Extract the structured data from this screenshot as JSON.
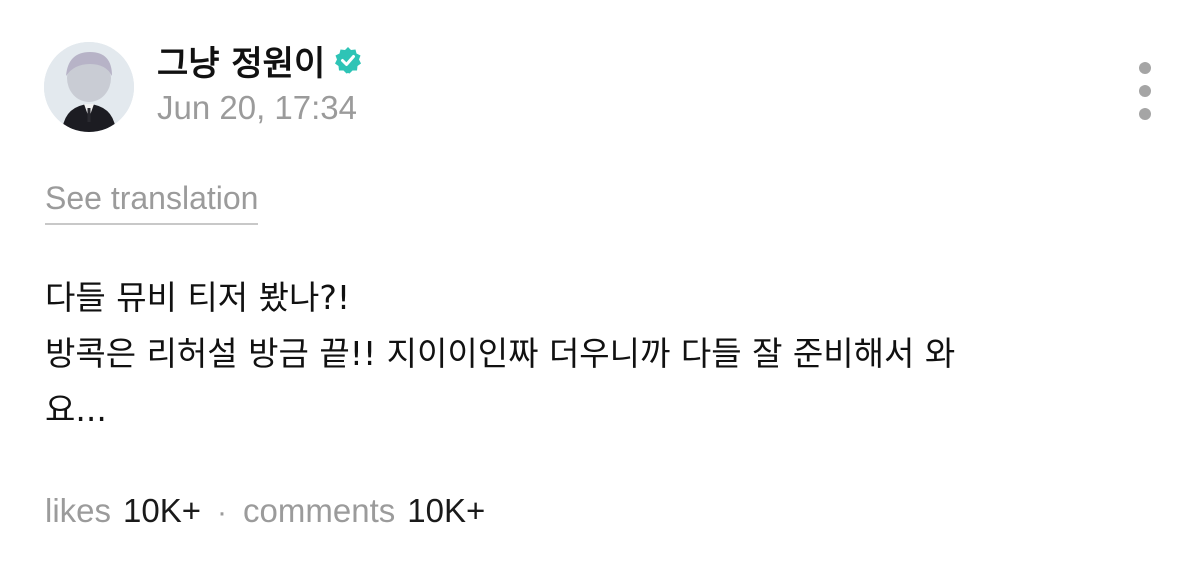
{
  "post": {
    "author": {
      "name": "그냥 정원이",
      "verified": true,
      "avatar_icon": "avatar-photo"
    },
    "timestamp": "Jun 20, 17:34",
    "see_translation": "See translation",
    "body_lines": [
      "다들 뮤비 티저 봤나?!",
      "방콕은 리허설 방금 끝!! 지이이인짜 더우니까 다들 잘 준비해서 와",
      "요..."
    ],
    "stats": {
      "likes_label": "likes",
      "likes_count": "10K+",
      "separator": "·",
      "comments_label": "comments",
      "comments_count": "10K+"
    }
  },
  "colors": {
    "verified_badge": "#2ec4b6",
    "muted_text": "#9b9b9b",
    "primary_text": "#111111"
  },
  "icons": {
    "verified": "verified-badge-icon",
    "more": "more-vertical-icon"
  }
}
